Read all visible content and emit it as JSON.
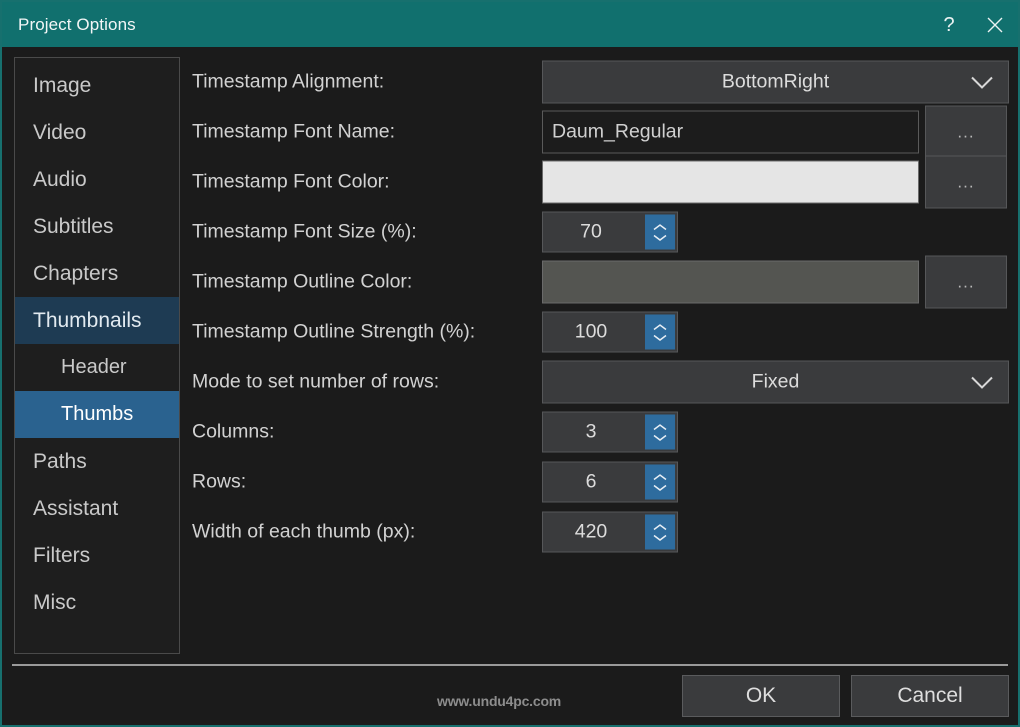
{
  "window": {
    "title": "Project Options",
    "help_label": "?",
    "close_label": "✕",
    "accent_color": "#11706e"
  },
  "sidebar": {
    "items": [
      {
        "label": "Image",
        "level": 0,
        "state": "normal"
      },
      {
        "label": "Video",
        "level": 0,
        "state": "normal"
      },
      {
        "label": "Audio",
        "level": 0,
        "state": "normal"
      },
      {
        "label": "Subtitles",
        "level": 0,
        "state": "normal"
      },
      {
        "label": "Chapters",
        "level": 0,
        "state": "normal"
      },
      {
        "label": "Thumbnails",
        "level": 0,
        "state": "selected-parent"
      },
      {
        "label": "Header",
        "level": 1,
        "state": "normal"
      },
      {
        "label": "Thumbs",
        "level": 1,
        "state": "selected"
      },
      {
        "label": "Paths",
        "level": 0,
        "state": "normal"
      },
      {
        "label": "Assistant",
        "level": 0,
        "state": "normal"
      },
      {
        "label": "Filters",
        "level": 0,
        "state": "normal"
      },
      {
        "label": "Misc",
        "level": 0,
        "state": "normal"
      }
    ]
  },
  "form": {
    "timestamp_alignment": {
      "label": "Timestamp Alignment:",
      "value": "BottomRight"
    },
    "timestamp_font_name": {
      "label": "Timestamp Font Name:",
      "value": "Daum_Regular",
      "browse_label": "..."
    },
    "timestamp_font_color": {
      "label": "Timestamp Font Color:",
      "color": "#e5e5e5",
      "browse_label": "..."
    },
    "timestamp_font_size": {
      "label": "Timestamp Font Size (%):",
      "value": "70"
    },
    "timestamp_outline_color": {
      "label": "Timestamp Outline Color:",
      "color": "#545551",
      "browse_label": "..."
    },
    "timestamp_outline_strength": {
      "label": "Timestamp Outline Strength (%):",
      "value": "100"
    },
    "rows_mode": {
      "label": "Mode to set number of rows:",
      "value": "Fixed"
    },
    "columns": {
      "label": "Columns:",
      "value": "3"
    },
    "rows": {
      "label": "Rows:",
      "value": "6"
    },
    "thumb_width": {
      "label": "Width of each thumb (px):",
      "value": "420"
    }
  },
  "footer": {
    "watermark": "www.undu4pc.com",
    "ok_label": "OK",
    "cancel_label": "Cancel"
  }
}
